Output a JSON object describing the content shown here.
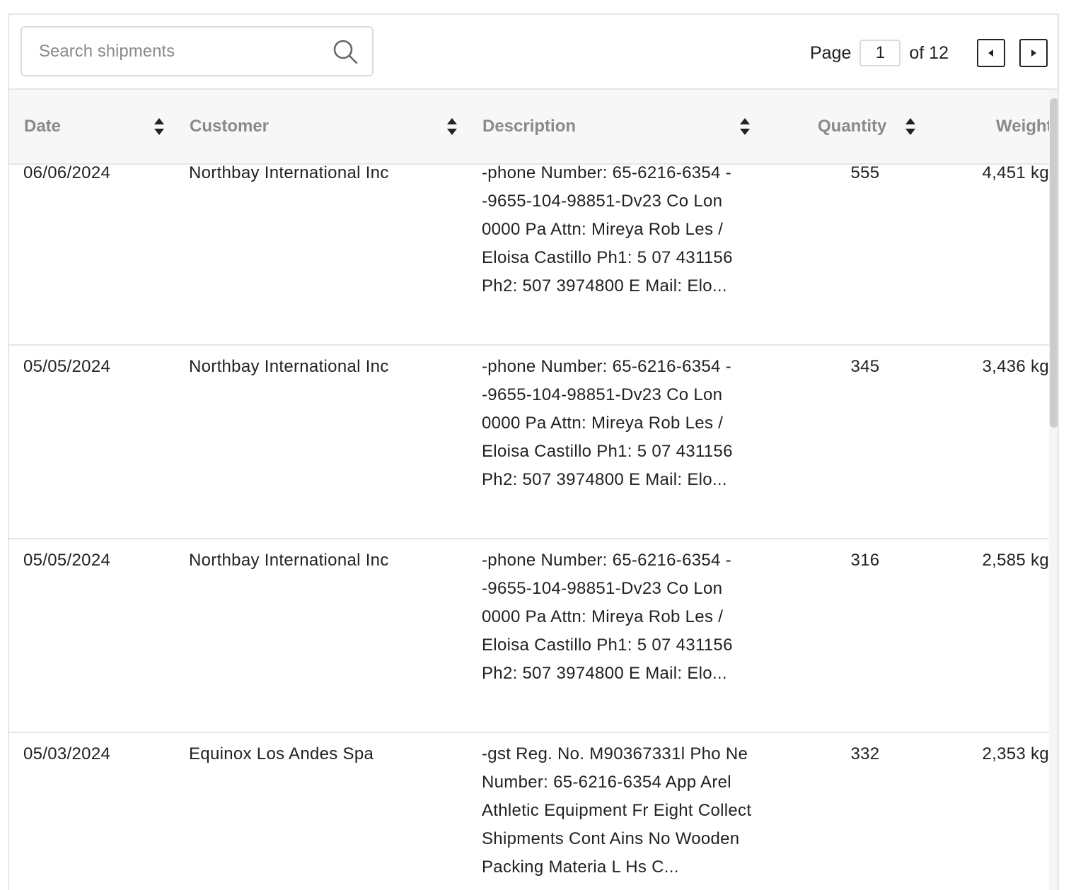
{
  "search": {
    "placeholder": "Search shipments"
  },
  "pagination": {
    "page_label": "Page",
    "current_page": "1",
    "of_label": "of 12"
  },
  "columns": {
    "date": "Date",
    "customer": "Customer",
    "description": "Description",
    "quantity": "Quantity",
    "weight": "Weight"
  },
  "rows": [
    {
      "date": "06/06/2024",
      "customer": "Northbay International Inc",
      "description": "-phone Number: 65-6216-6354 --9655-104-98851-Dv23 Co Lon 0000 Pa Attn: Mireya Rob Les / Eloisa Castillo Ph1: 5 07 431156 Ph2: 507 3974800 E Mail: Elo...",
      "quantity": "555",
      "weight": "4,451 kg"
    },
    {
      "date": "05/05/2024",
      "customer": "Northbay International Inc",
      "description": "-phone Number: 65-6216-6354 --9655-104-98851-Dv23 Co Lon 0000 Pa Attn: Mireya Rob Les / Eloisa Castillo Ph1: 5 07 431156 Ph2: 507 3974800 E Mail: Elo...",
      "quantity": "345",
      "weight": "3,436 kg"
    },
    {
      "date": "05/05/2024",
      "customer": "Northbay International Inc",
      "description": "-phone Number: 65-6216-6354 --9655-104-98851-Dv23 Co Lon 0000 Pa Attn: Mireya Rob Les / Eloisa Castillo Ph1: 5 07 431156 Ph2: 507 3974800 E Mail: Elo...",
      "quantity": "316",
      "weight": "2,585 kg"
    },
    {
      "date": "05/03/2024",
      "customer": "Equinox Los Andes Spa",
      "description": "-gst Reg. No. M90367331l Pho Ne Number: 65-6216-6354 App Arel Athletic Equipment Fr Eight Collect Shipments Cont Ains No Wooden Packing Materia L Hs C...",
      "quantity": "332",
      "weight": "2,353 kg"
    }
  ]
}
